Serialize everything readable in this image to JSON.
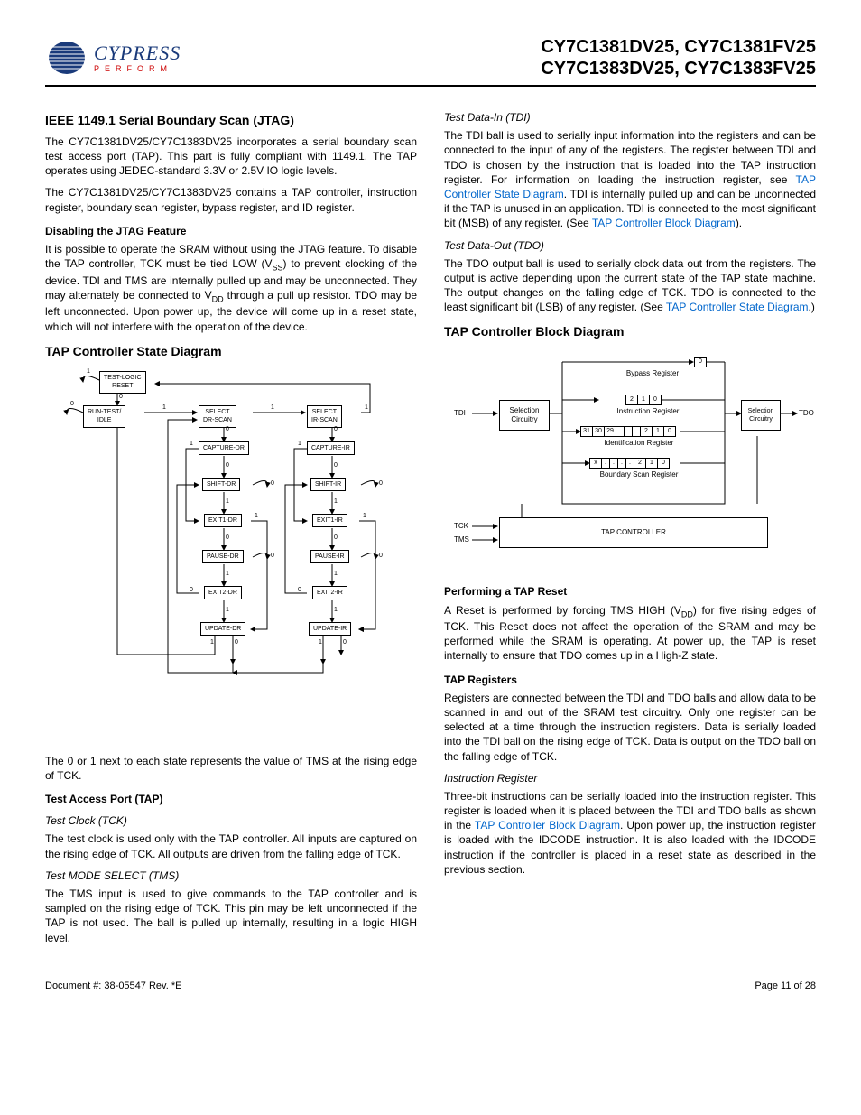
{
  "header": {
    "brand": "CYPRESS",
    "tagline": "PERFORM",
    "parts_line1": "CY7C1381DV25, CY7C1381FV25",
    "parts_line2": "CY7C1383DV25, CY7C1383FV25"
  },
  "left": {
    "h_jtag": "IEEE 1149.1 Serial Boundary Scan (JTAG)",
    "p_jtag1": "The CY7C1381DV25/CY7C1383DV25 incorporates a serial boundary scan test access port (TAP). This part is fully compliant with 1149.1. The TAP operates using JEDEC-standard 3.3V or 2.5V IO logic levels.",
    "p_jtag2": "The CY7C1381DV25/CY7C1383DV25 contains a TAP controller, instruction register, boundary scan register, bypass register, and ID register.",
    "h_disable": "Disabling the JTAG Feature",
    "p_disable_a": "It is possible to operate the SRAM without using the JTAG feature. To disable the TAP controller, TCK must be tied LOW (V",
    "p_disable_b": ") to prevent clocking of the device. TDI and TMS are internally pulled up and may be unconnected. They may alternately be connected to V",
    "p_disable_c": " through a pull up resistor. TDO may be left unconnected. Upon power up, the device will come up in a reset state, which will not interfere with the operation of the device.",
    "sub_ss": "SS",
    "sub_dd": "DD",
    "h_statediag": "TAP Controller State Diagram",
    "states": {
      "tlr": "TEST-LOGIC\nRESET",
      "rti": "RUN-TEST/\nIDLE",
      "sdr": "SELECT\nDR-SCAN",
      "sir": "SELECT\nIR-SCAN",
      "cdr": "CAPTURE-DR",
      "cir": "CAPTURE-IR",
      "shdr": "SHIFT-DR",
      "shir": "SHIFT-IR",
      "e1dr": "EXIT1-DR",
      "e1ir": "EXIT1-IR",
      "pdr": "PAUSE-DR",
      "pir": "PAUSE-IR",
      "e2dr": "EXIT2-DR",
      "e2ir": "EXIT2-IR",
      "udr": "UPDATE-DR",
      "uir": "UPDATE-IR"
    },
    "p_sd_note": "The 0 or 1 next to each state represents the value of TMS at the rising edge of TCK.",
    "h_tap": "Test Access Port (TAP)",
    "h_tck": "Test Clock (TCK)",
    "p_tck": "The test clock is used only with the TAP controller. All inputs are captured on the rising edge of TCK. All outputs are driven from the falling edge of TCK.",
    "h_tms": "Test MODE SELECT (TMS)",
    "p_tms": "The TMS input is used to give commands to the TAP controller and is sampled on the rising edge of TCK. This pin may be left unconnected if the TAP is not used. The ball is pulled up internally, resulting in a logic HIGH level."
  },
  "right": {
    "h_tdi": "Test Data-In (TDI)",
    "p_tdi_a": "The TDI ball is used to serially input information into the registers and can be connected to the input of any of the registers. The register between TDI and TDO is chosen by the instruction that is loaded into the TAP instruction register. For information on loading the instruction register, see ",
    "p_tdi_link1": "TAP Controller State Diagram",
    "p_tdi_b": ". TDI is internally pulled up and can be unconnected if the TAP is unused in an application. TDI is connected to the most significant bit (MSB) of any register. (See ",
    "p_tdi_link2": "TAP Controller Block Diagram",
    "p_tdi_c": ").",
    "h_tdo": "Test Data-Out (TDO)",
    "p_tdo_a": "The TDO output ball is used to serially clock data out from the registers. The output is active depending upon the current state of the TAP state machine. The output changes on the falling edge of TCK. TDO is connected to the least significant bit (LSB) of any register. (See ",
    "p_tdo_link": "TAP Controller State Diagram",
    "p_tdo_b": ".)",
    "h_block": "TAP Controller Block Diagram",
    "bd": {
      "bypass": "Bypass Register",
      "instr": "Instruction Register",
      "ident": "Identification Register",
      "bscan": "Boundary Scan Register",
      "selc": "Selection\nCircuitry",
      "selc2": "Selection\nCircuitry",
      "tapc": "TAP CONTROLLER",
      "tdi": "TDI",
      "tdo": "TDO",
      "tck": "TCK",
      "tms": "TMS",
      "ir_bits": [
        "2",
        "1",
        "0"
      ],
      "id_bits": [
        "31",
        "30",
        "29",
        ".",
        ".",
        ".",
        "2",
        "1",
        "0"
      ],
      "bs_bits": [
        "x",
        ".",
        ".",
        ".",
        ".",
        "2",
        "1",
        "0"
      ],
      "byp_bit": "0"
    },
    "h_reset": "Performing a TAP Reset",
    "p_reset_a": "A Reset is performed by forcing TMS HIGH (V",
    "p_reset_b": ") for five rising edges of TCK. This Reset does not affect the operation of the SRAM and may be performed while the SRAM is operating. At power up, the TAP is reset internally to ensure that TDO comes up in a High-Z state.",
    "h_tapreg": "TAP Registers",
    "p_tapreg": "Registers are connected between the TDI and TDO balls and allow data to be scanned in and out of the SRAM test circuitry. Only one register can be selected at a time through the instruction registers. Data is serially loaded into the TDI ball on the rising edge of TCK. Data is output on the TDO ball on the falling edge of TCK.",
    "h_ir": "Instruction Register",
    "p_ir_a": "Three-bit instructions can be serially loaded into the instruction register. This register is loaded when it is placed between the TDI and TDO balls as shown in the ",
    "p_ir_link": "TAP Controller Block Diagram",
    "p_ir_b": ". Upon power up, the instruction register is loaded with the IDCODE instruction. It is also loaded with the IDCODE instruction if the controller is placed in a reset state as described in the previous section."
  },
  "footer": {
    "doc": "Document #: 38-05547 Rev. *E",
    "page": "Page 11 of 28"
  }
}
